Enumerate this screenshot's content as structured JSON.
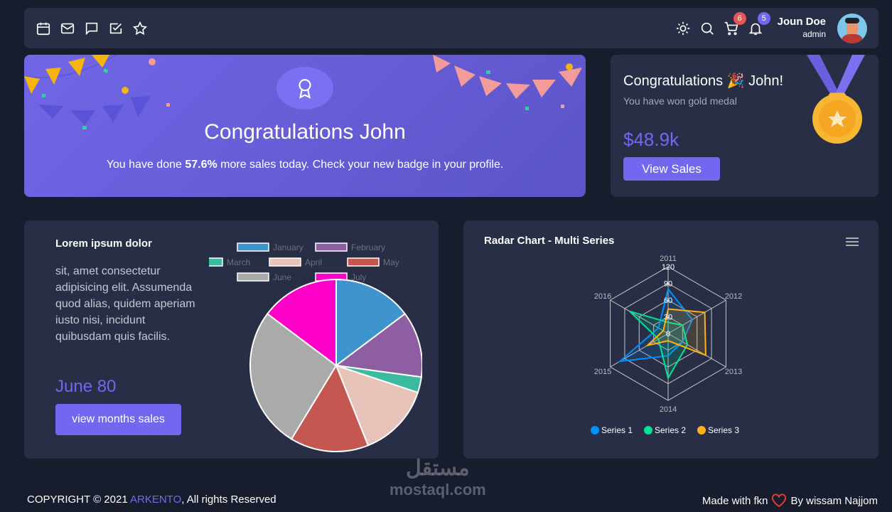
{
  "nav": {
    "icons": [
      "calendar-icon",
      "mail-icon",
      "chat-icon",
      "checkbox-icon",
      "star-icon"
    ],
    "cart_count": "6",
    "bell_count": "5",
    "user_name": "Joun Doe",
    "user_role": "admin",
    "badge_colors": {
      "cart": "#ea5455",
      "bell": "#7367f0"
    }
  },
  "banner": {
    "title": "Congratulations John",
    "text_pre": "You have done ",
    "text_bold": "57.6%",
    "text_post": " more sales today. Check your new badge in your profile."
  },
  "medal": {
    "title": "Congratulations",
    "emoji": "🎉",
    "title_end": "John!",
    "subtitle": "You have won gold medal",
    "amount": "$48.9k",
    "button": "View Sales"
  },
  "pie_card": {
    "title": "Lorem ipsum dolor",
    "text": "sit, amet consectetur adipisicing elit. Assumenda quod alias, quidem aperiam iusto nisi, incidunt quibusdam quis facilis.",
    "highlight": "June 80",
    "button": "view months sales"
  },
  "radar_card": {
    "title": "Radar Chart - Multi Series"
  },
  "chart_data": [
    {
      "type": "pie",
      "categories": [
        "January",
        "February",
        "March",
        "April",
        "May",
        "June",
        "July"
      ],
      "values": [
        50,
        42,
        10,
        47,
        50,
        90,
        50
      ],
      "colors": [
        "#3e95cd",
        "#8e5ea2",
        "#3cba9f",
        "#e8c3b9",
        "#c45850",
        "#aaaaaa",
        "#ff00c8"
      ],
      "legend": "top"
    },
    {
      "type": "radar",
      "title": "Radar Chart - Multi Series",
      "categories": [
        "2011",
        "2012",
        "2013",
        "2014",
        "2015",
        "2016"
      ],
      "ticks": [
        "0",
        "30",
        "60",
        "90",
        "120"
      ],
      "range": [
        0,
        120
      ],
      "series": [
        {
          "name": "Series 1",
          "values": [
            80,
            50,
            30,
            40,
            100,
            20
          ],
          "color": "#008ffb"
        },
        {
          "name": "Series 2",
          "values": [
            20,
            30,
            40,
            80,
            20,
            80
          ],
          "color": "#00e396"
        },
        {
          "name": "Series 3",
          "values": [
            44,
            76,
            78,
            13,
            43,
            10
          ],
          "color": "#feb019"
        }
      ],
      "legend": "bottom"
    }
  ],
  "footer": {
    "copy_pre": "COPYRIGHT © 2021 ",
    "brand": "ARKENTO",
    "copy_post": ", All rights Reserved",
    "made_pre": "Made with fkn",
    "made_post": "By wissam Najjom"
  },
  "watermark": {
    "ar": "مستقل",
    "en": "mostaql.com"
  }
}
